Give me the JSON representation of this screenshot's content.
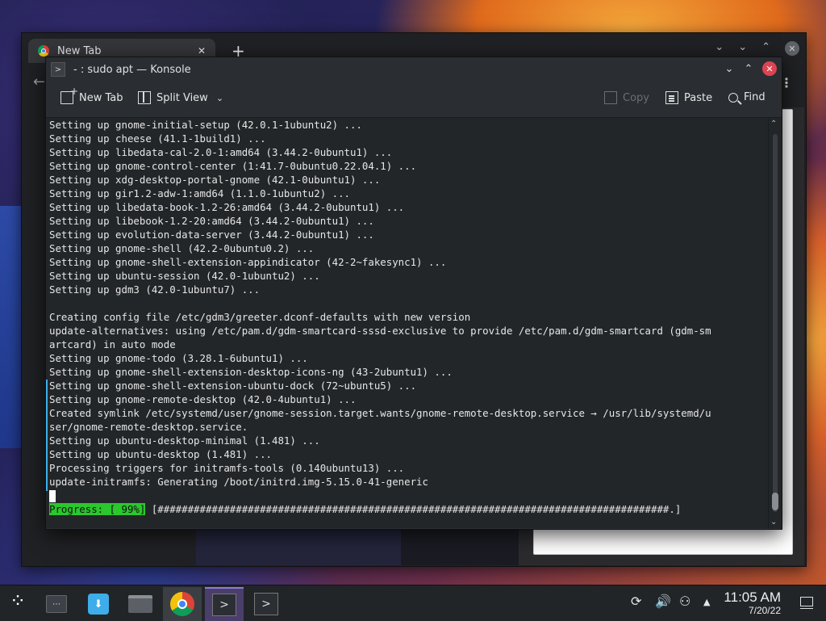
{
  "chrome": {
    "tab_title": "New Tab",
    "tab_close": "✕",
    "new_tab": "+",
    "back": "←",
    "menu": "⋮",
    "controls": [
      "⌄",
      "⌄",
      "⌃",
      "✕"
    ]
  },
  "konsole": {
    "window_title": "- : sudo apt — Konsole",
    "app_icon": ">",
    "controls": {
      "minimize": "⌄",
      "maximize": "⌃",
      "close": "✕"
    },
    "toolbar": {
      "new_tab": "New Tab",
      "split_view": "Split View",
      "split_view_chevron": "⌄",
      "copy": "Copy",
      "paste": "Paste",
      "find": "Find"
    },
    "terminal_lines": [
      "Setting up gnome-initial-setup (42.0.1-1ubuntu2) ...",
      "Setting up cheese (41.1-1build1) ...",
      "Setting up libedata-cal-2.0-1:amd64 (3.44.2-0ubuntu1) ...",
      "Setting up gnome-control-center (1:41.7-0ubuntu0.22.04.1) ...",
      "Setting up xdg-desktop-portal-gnome (42.1-0ubuntu1) ...",
      "Setting up gir1.2-adw-1:amd64 (1.1.0-1ubuntu2) ...",
      "Setting up libedata-book-1.2-26:amd64 (3.44.2-0ubuntu1) ...",
      "Setting up libebook-1.2-20:amd64 (3.44.2-0ubuntu1) ...",
      "Setting up evolution-data-server (3.44.2-0ubuntu1) ...",
      "Setting up gnome-shell (42.2-0ubuntu0.2) ...",
      "Setting up gnome-shell-extension-appindicator (42-2~fakesync1) ...",
      "Setting up ubuntu-session (42.0-1ubuntu2) ...",
      "Setting up gdm3 (42.0-1ubuntu7) ...",
      "",
      "Creating config file /etc/gdm3/greeter.dconf-defaults with new version",
      "update-alternatives: using /etc/pam.d/gdm-smartcard-sssd-exclusive to provide /etc/pam.d/gdm-smartcard (gdm-sm",
      "artcard) in auto mode",
      "Setting up gnome-todo (3.28.1-6ubuntu1) ...",
      "Setting up gnome-shell-extension-desktop-icons-ng (43-2ubuntu1) ...",
      "Setting up gnome-shell-extension-ubuntu-dock (72~ubuntu5) ...",
      "Setting up gnome-remote-desktop (42.0-4ubuntu1) ...",
      "Created symlink /etc/systemd/user/gnome-session.target.wants/gnome-remote-desktop.service → /usr/lib/systemd/u",
      "ser/gnome-remote-desktop.service.",
      "Setting up ubuntu-desktop-minimal (1.481) ...",
      "Setting up ubuntu-desktop (1.481) ...",
      "Processing triggers for initramfs-tools (0.140ubuntu13) ...",
      "update-initramfs: Generating /boot/initrd.img-5.15.0-41-generic"
    ],
    "progress": {
      "label": "Progress: [ 99%]",
      "bar": " [#####################################################################################.]",
      "percent": 99
    },
    "scroll_up": "⌃",
    "scroll_down": "⌄"
  },
  "taskbar": {
    "clock_time": "11:05 AM",
    "clock_date": "7/20/22",
    "konsole_icon": ">",
    "discover_icon": "⬇",
    "tray_volume": "🔊",
    "tray_expand": "▲",
    "tray_network": "⚇",
    "tray_updates": "⟳"
  },
  "colors": {
    "terminal_bg": "#232629",
    "progress_green": "#2ac72d",
    "close_red": "#da4453",
    "accent_blue": "#3daee9"
  }
}
